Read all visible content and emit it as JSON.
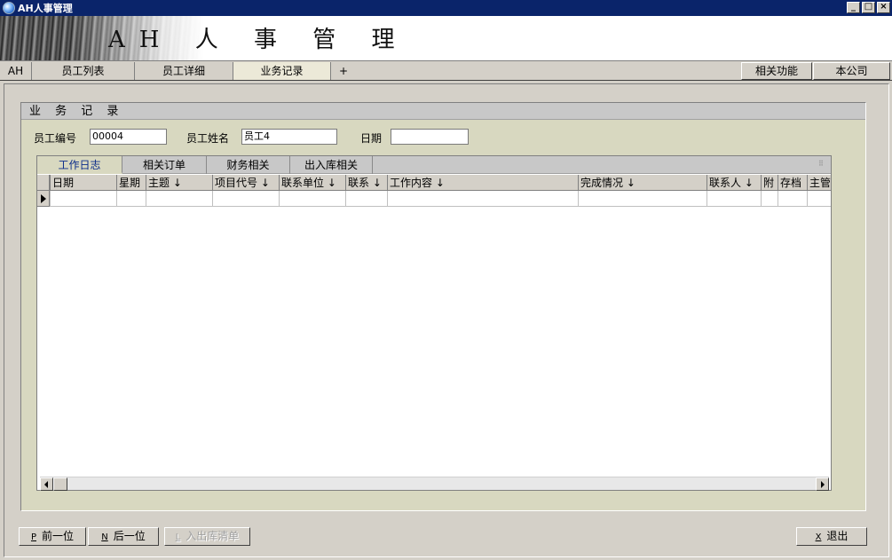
{
  "window": {
    "title": "AH人事管理",
    "controls": [
      "_",
      "□",
      "×"
    ]
  },
  "banner": {
    "title": "AH 人 事 管 理"
  },
  "main_tabs": [
    {
      "label": "AH"
    },
    {
      "label": "员工列表"
    },
    {
      "label": "员工详细"
    },
    {
      "label": "业务记录",
      "active": true
    },
    {
      "label": "+"
    }
  ],
  "right_buttons": [
    {
      "label": "相关功能"
    },
    {
      "label": "本公司"
    }
  ],
  "panel": {
    "title": "业 务 记 录",
    "fields": {
      "emp_no_label": "员工编号",
      "emp_no_value": "00004",
      "emp_name_label": "员工姓名",
      "emp_name_value": "员工4",
      "date_label": "日期",
      "date_value": ""
    }
  },
  "sub_tabs": [
    {
      "label": "工作日志",
      "active": true
    },
    {
      "label": "相关订单"
    },
    {
      "label": "财务相关"
    },
    {
      "label": "出入库相关"
    }
  ],
  "grid": {
    "columns": [
      "日期",
      "星期",
      "主题 ↓",
      "项目代号 ↓",
      "联系单位 ↓",
      "联系 ↓",
      "工作内容 ↓",
      "完成情况 ↓",
      "联系人 ↓",
      "附",
      "存档",
      "主管"
    ]
  },
  "bottom_buttons": {
    "prev": {
      "hotkey": "P",
      "label": "前一位"
    },
    "next": {
      "hotkey": "N",
      "label": "后一位"
    },
    "list": {
      "hotkey": "L",
      "label": "入出库清单"
    },
    "exit": {
      "hotkey": "X",
      "label": "退出"
    }
  }
}
